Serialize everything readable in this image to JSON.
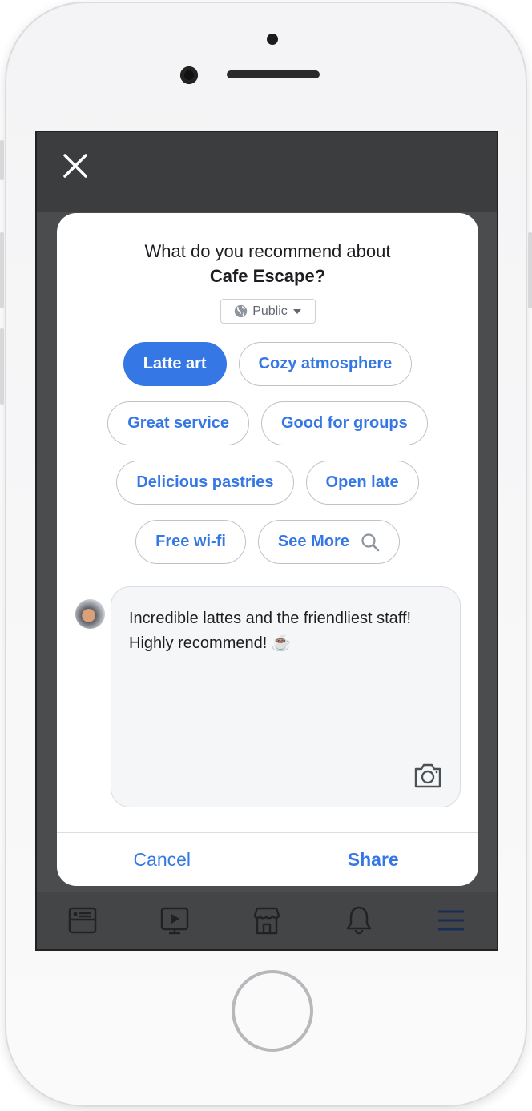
{
  "dialog": {
    "title_line1": "What do you recommend about",
    "place_name": "Cafe Escape?",
    "privacy": {
      "label": "Public",
      "icon": "globe-icon"
    },
    "chips": [
      {
        "label": "Latte art",
        "selected": true
      },
      {
        "label": "Cozy atmosphere",
        "selected": false
      },
      {
        "label": "Great service",
        "selected": false
      },
      {
        "label": "Good for groups",
        "selected": false
      },
      {
        "label": "Delicious pastries",
        "selected": false
      },
      {
        "label": "Open late",
        "selected": false
      },
      {
        "label": "Free wi-fi",
        "selected": false
      },
      {
        "label": "See More",
        "selected": false,
        "icon": "search-icon"
      }
    ],
    "composer_text": "Incredible lattes and the friendliest staff! Highly recommend! ☕",
    "cancel_label": "Cancel",
    "share_label": "Share"
  },
  "tabbar": [
    "news-feed-icon",
    "watch-icon",
    "marketplace-icon",
    "notifications-icon",
    "menu-icon"
  ],
  "colors": {
    "accent": "#3578e5",
    "overlay": "#4b4c4e"
  }
}
